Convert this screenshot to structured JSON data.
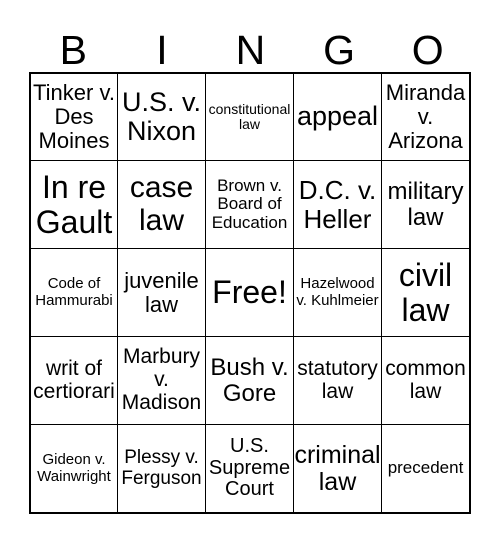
{
  "header": [
    "B",
    "I",
    "N",
    "G",
    "O"
  ],
  "cells": [
    "Tinker v. Des Moines",
    "U.S. v. Nixon",
    "constitutional law",
    "appeal",
    "Miranda v. Arizona",
    "In re Gault",
    "case law",
    "Brown v. Board of Education",
    "D.C. v. Heller",
    "military law",
    "Code of Hammurabi",
    "juvenile law",
    "Free!",
    "Hazelwood v. Kuhlmeier",
    "civil law",
    "writ of certiorari",
    "Marbury v. Madison",
    "Bush v. Gore",
    "statutory law",
    "common law",
    "Gideon v. Wainwright",
    "Plessy v. Ferguson",
    "U.S. Supreme Court",
    "criminal law",
    "precedent"
  ]
}
